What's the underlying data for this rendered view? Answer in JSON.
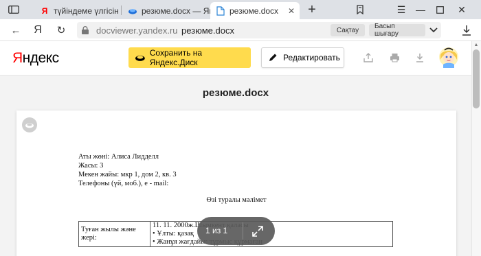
{
  "browser": {
    "tabs": [
      {
        "title": "түйіндеме үлгісін ж",
        "favicon": "yandex-y",
        "active": false
      },
      {
        "title": "резюме.docx — Янд",
        "favicon": "yandex-disk",
        "active": false
      },
      {
        "title": "резюме.docx",
        "favicon": "document",
        "active": true
      }
    ],
    "address": {
      "domain": "docviewer.yandex.ru",
      "path": "резюме.docx",
      "save_chip": "Сақтау",
      "print_chip": "Басып шығару"
    },
    "yandex_button": "Я"
  },
  "viewer": {
    "logo": "Яндекс",
    "save_to_disk": "Сохранить на Яндекс.Диск",
    "edit": "Редактировать",
    "doc_title": "резюме.docx",
    "pager": "1 из 1",
    "accent_color": "#ffdb4d"
  },
  "document": {
    "lines": [
      "Аты жөні: Алиса Лидделл",
      "Жасы: 3",
      "Мекен жайы: мкр 1, дом 2, кв. 3",
      "Телефоны (үй, моб.), е - mail:"
    ],
    "section_title": "Өзі туралы мәлімет",
    "table": {
      "label": "Туған жылы және жері:",
      "values": [
        "11. 11. 2000ж.Шымкент қаласы",
        "• Ұлты: қазақ",
        "• Жанұя жағдайы: тұрмыс құрмаған"
      ]
    }
  }
}
